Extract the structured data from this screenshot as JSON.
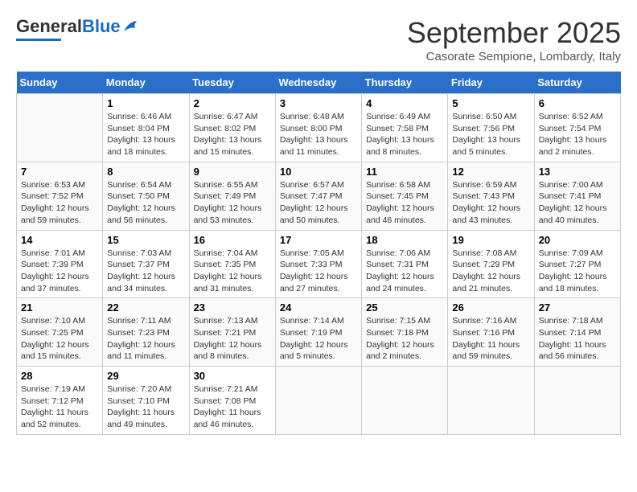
{
  "header": {
    "logo_general": "General",
    "logo_blue": "Blue",
    "month_title": "September 2025",
    "location": "Casorate Sempione, Lombardy, Italy"
  },
  "days_of_week": [
    "Sunday",
    "Monday",
    "Tuesday",
    "Wednesday",
    "Thursday",
    "Friday",
    "Saturday"
  ],
  "weeks": [
    [
      {
        "day": "",
        "info": ""
      },
      {
        "day": "1",
        "info": "Sunrise: 6:46 AM\nSunset: 8:04 PM\nDaylight: 13 hours\nand 18 minutes."
      },
      {
        "day": "2",
        "info": "Sunrise: 6:47 AM\nSunset: 8:02 PM\nDaylight: 13 hours\nand 15 minutes."
      },
      {
        "day": "3",
        "info": "Sunrise: 6:48 AM\nSunset: 8:00 PM\nDaylight: 13 hours\nand 11 minutes."
      },
      {
        "day": "4",
        "info": "Sunrise: 6:49 AM\nSunset: 7:58 PM\nDaylight: 13 hours\nand 8 minutes."
      },
      {
        "day": "5",
        "info": "Sunrise: 6:50 AM\nSunset: 7:56 PM\nDaylight: 13 hours\nand 5 minutes."
      },
      {
        "day": "6",
        "info": "Sunrise: 6:52 AM\nSunset: 7:54 PM\nDaylight: 13 hours\nand 2 minutes."
      }
    ],
    [
      {
        "day": "7",
        "info": "Sunrise: 6:53 AM\nSunset: 7:52 PM\nDaylight: 12 hours\nand 59 minutes."
      },
      {
        "day": "8",
        "info": "Sunrise: 6:54 AM\nSunset: 7:50 PM\nDaylight: 12 hours\nand 56 minutes."
      },
      {
        "day": "9",
        "info": "Sunrise: 6:55 AM\nSunset: 7:49 PM\nDaylight: 12 hours\nand 53 minutes."
      },
      {
        "day": "10",
        "info": "Sunrise: 6:57 AM\nSunset: 7:47 PM\nDaylight: 12 hours\nand 50 minutes."
      },
      {
        "day": "11",
        "info": "Sunrise: 6:58 AM\nSunset: 7:45 PM\nDaylight: 12 hours\nand 46 minutes."
      },
      {
        "day": "12",
        "info": "Sunrise: 6:59 AM\nSunset: 7:43 PM\nDaylight: 12 hours\nand 43 minutes."
      },
      {
        "day": "13",
        "info": "Sunrise: 7:00 AM\nSunset: 7:41 PM\nDaylight: 12 hours\nand 40 minutes."
      }
    ],
    [
      {
        "day": "14",
        "info": "Sunrise: 7:01 AM\nSunset: 7:39 PM\nDaylight: 12 hours\nand 37 minutes."
      },
      {
        "day": "15",
        "info": "Sunrise: 7:03 AM\nSunset: 7:37 PM\nDaylight: 12 hours\nand 34 minutes."
      },
      {
        "day": "16",
        "info": "Sunrise: 7:04 AM\nSunset: 7:35 PM\nDaylight: 12 hours\nand 31 minutes."
      },
      {
        "day": "17",
        "info": "Sunrise: 7:05 AM\nSunset: 7:33 PM\nDaylight: 12 hours\nand 27 minutes."
      },
      {
        "day": "18",
        "info": "Sunrise: 7:06 AM\nSunset: 7:31 PM\nDaylight: 12 hours\nand 24 minutes."
      },
      {
        "day": "19",
        "info": "Sunrise: 7:08 AM\nSunset: 7:29 PM\nDaylight: 12 hours\nand 21 minutes."
      },
      {
        "day": "20",
        "info": "Sunrise: 7:09 AM\nSunset: 7:27 PM\nDaylight: 12 hours\nand 18 minutes."
      }
    ],
    [
      {
        "day": "21",
        "info": "Sunrise: 7:10 AM\nSunset: 7:25 PM\nDaylight: 12 hours\nand 15 minutes."
      },
      {
        "day": "22",
        "info": "Sunrise: 7:11 AM\nSunset: 7:23 PM\nDaylight: 12 hours\nand 11 minutes."
      },
      {
        "day": "23",
        "info": "Sunrise: 7:13 AM\nSunset: 7:21 PM\nDaylight: 12 hours\nand 8 minutes."
      },
      {
        "day": "24",
        "info": "Sunrise: 7:14 AM\nSunset: 7:19 PM\nDaylight: 12 hours\nand 5 minutes."
      },
      {
        "day": "25",
        "info": "Sunrise: 7:15 AM\nSunset: 7:18 PM\nDaylight: 12 hours\nand 2 minutes."
      },
      {
        "day": "26",
        "info": "Sunrise: 7:16 AM\nSunset: 7:16 PM\nDaylight: 11 hours\nand 59 minutes."
      },
      {
        "day": "27",
        "info": "Sunrise: 7:18 AM\nSunset: 7:14 PM\nDaylight: 11 hours\nand 56 minutes."
      }
    ],
    [
      {
        "day": "28",
        "info": "Sunrise: 7:19 AM\nSunset: 7:12 PM\nDaylight: 11 hours\nand 52 minutes."
      },
      {
        "day": "29",
        "info": "Sunrise: 7:20 AM\nSunset: 7:10 PM\nDaylight: 11 hours\nand 49 minutes."
      },
      {
        "day": "30",
        "info": "Sunrise: 7:21 AM\nSunset: 7:08 PM\nDaylight: 11 hours\nand 46 minutes."
      },
      {
        "day": "",
        "info": ""
      },
      {
        "day": "",
        "info": ""
      },
      {
        "day": "",
        "info": ""
      },
      {
        "day": "",
        "info": ""
      }
    ]
  ]
}
